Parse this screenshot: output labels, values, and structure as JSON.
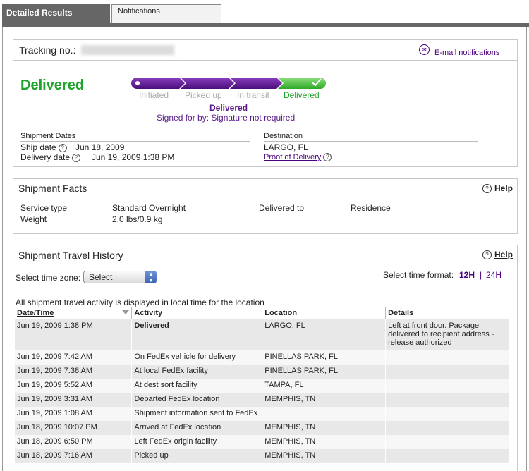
{
  "tabs": [
    {
      "label": "Detailed Results",
      "active": true
    },
    {
      "label": "Notifications",
      "active": false
    }
  ],
  "tracking": {
    "label": "Tracking no.:",
    "email_link": "E-mail notifications",
    "status": "Delivered",
    "steps": [
      "Initiated",
      "Picked up",
      "In transit",
      "Delivered"
    ],
    "current_step_index": 3,
    "status_line": "Delivered",
    "signed_for": "Signed for by:  Signature not required",
    "shipment_dates_label": "Shipment Dates",
    "ship_date_label": "Ship date",
    "ship_date": "Jun 18, 2009",
    "delivery_date_label": "Delivery date",
    "delivery_date": "Jun 19, 2009 1:38 PM",
    "destination_label": "Destination",
    "destination": "LARGO, FL",
    "proof_link": "Proof of Delivery"
  },
  "facts": {
    "title": "Shipment Facts",
    "help": "Help",
    "service_type_label": "Service type",
    "service_type": "Standard Overnight",
    "weight_label": "Weight",
    "weight": "2.0 lbs/0.9 kg",
    "delivered_to_label": "Delivered to",
    "delivered_to": "Residence"
  },
  "history": {
    "title": "Shipment Travel History",
    "help": "Help",
    "timezone_label": "Select time zone:",
    "timezone_value": "Select",
    "time_format_label": "Select time format:",
    "format_12": "12H",
    "format_sep": "|",
    "format_24": "24H",
    "note": "All shipment travel activity is displayed in local time for the location",
    "columns": [
      "Date/Time",
      "Activity",
      "Location",
      "Details"
    ],
    "rows": [
      {
        "datetime": "Jun 19, 2009 1:38 PM",
        "activity": "Delivered",
        "location": "LARGO, FL",
        "details": "Left at front door. Package delivered to recipient address - release authorized"
      },
      {
        "datetime": "Jun 19, 2009 7:42 AM",
        "activity": "On FedEx vehicle for delivery",
        "location": "PINELLAS PARK, FL",
        "details": ""
      },
      {
        "datetime": "Jun 19, 2009 7:38 AM",
        "activity": "At local FedEx facility",
        "location": "PINELLAS PARK, FL",
        "details": ""
      },
      {
        "datetime": "Jun 19, 2009 5:52 AM",
        "activity": "At dest sort facility",
        "location": "TAMPA, FL",
        "details": ""
      },
      {
        "datetime": "Jun 19, 2009 3:31 AM",
        "activity": "Departed FedEx location",
        "location": "MEMPHIS, TN",
        "details": ""
      },
      {
        "datetime": "Jun 19, 2009 1:08 AM",
        "activity": "Shipment information sent to FedEx",
        "location": "",
        "details": ""
      },
      {
        "datetime": "Jun 18, 2009 10:07 PM",
        "activity": "Arrived at FedEx location",
        "location": "MEMPHIS, TN",
        "details": ""
      },
      {
        "datetime": "Jun 18, 2009 6:50 PM",
        "activity": "Left FedEx origin facility",
        "location": "MEMPHIS, TN",
        "details": ""
      },
      {
        "datetime": "Jun 18, 2009 7:16 AM",
        "activity": "Picked up",
        "location": "MEMPHIS, TN",
        "details": ""
      }
    ]
  },
  "colors": {
    "purple": "#5a1a8c",
    "green": "#1fa32a",
    "tab_gray": "#666666"
  }
}
